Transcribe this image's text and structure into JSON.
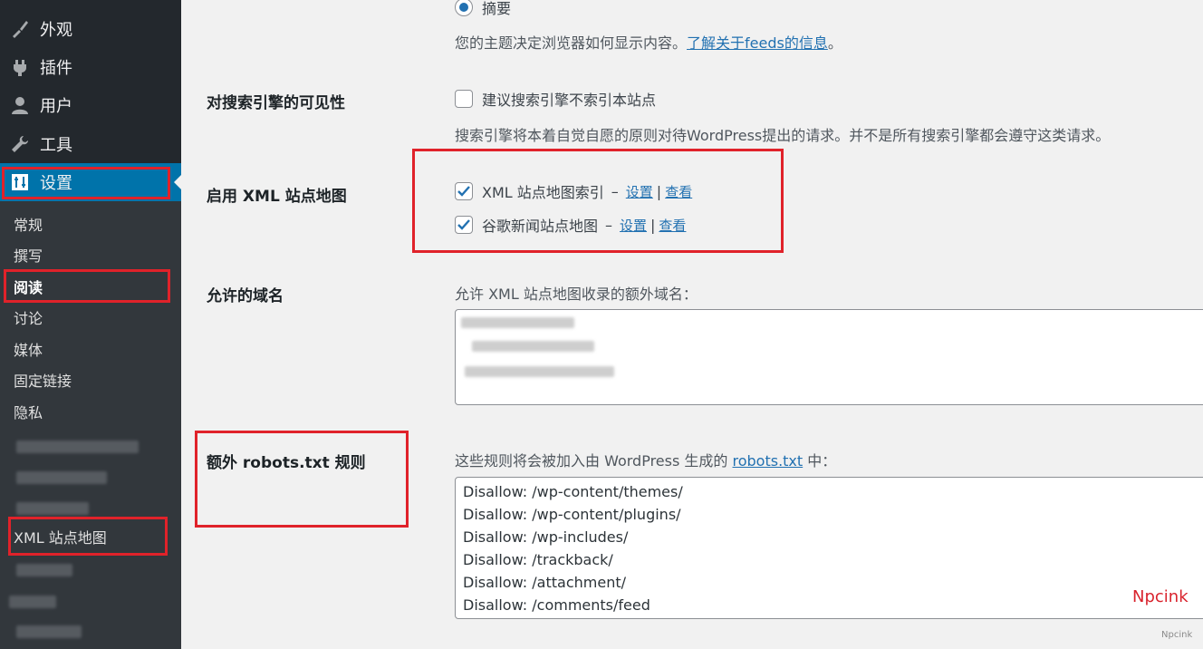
{
  "sidebar": {
    "menu": [
      {
        "label": "外观",
        "icon": "brush-icon"
      },
      {
        "label": "插件",
        "icon": "plugin-icon"
      },
      {
        "label": "用户",
        "icon": "user-icon"
      },
      {
        "label": "工具",
        "icon": "wrench-icon"
      },
      {
        "label": "设置",
        "icon": "settings-icon"
      }
    ],
    "submenu": [
      "常规",
      "撰写",
      "阅读",
      "讨论",
      "媒体",
      "固定链接",
      "隐私",
      "XML 站点地图"
    ]
  },
  "feed": {
    "option_summary": "摘要",
    "desc": "您的主题决定浏览器如何显示内容。",
    "link": "了解关于feeds的信息",
    "period": "。"
  },
  "visibility": {
    "label": "对搜索引擎的可见性",
    "checkbox": "建议搜索引擎不索引本站点",
    "desc": "搜索引擎将本着自觉自愿的原则对待WordPress提出的请求。并不是所有搜索引擎都会遵守这类请求。"
  },
  "sitemap": {
    "label": "启用 XML 站点地图",
    "items": [
      {
        "label": "XML 站点地图索引",
        "dash": "–",
        "settings": "设置",
        "pipe": "|",
        "view": "查看"
      },
      {
        "label": "谷歌新闻站点地图",
        "dash": "–",
        "settings": "设置",
        "pipe": "|",
        "view": "查看"
      }
    ]
  },
  "domains": {
    "label": "允许的域名",
    "desc": "允许 XML 站点地图收录的额外域名："
  },
  "robots": {
    "label": "额外 robots.txt 规则",
    "desc_prefix": "这些规则将会被加入由 WordPress 生成的 ",
    "desc_link": "robots.txt",
    "desc_suffix": " 中：",
    "lines": [
      "Disallow: /wp-content/themes/",
      "Disallow: /wp-content/plugins/",
      "Disallow: /wp-includes/",
      "Disallow: /trackback/",
      "Disallow: /attachment/",
      "Disallow: /comments/feed"
    ]
  },
  "watermark": {
    "red": "Npcink",
    "small": "Npcink"
  },
  "colors": {
    "sidebar": "#23282d",
    "active": "#0073aa",
    "highlight": "#e0222a",
    "link": "#2271b1"
  }
}
